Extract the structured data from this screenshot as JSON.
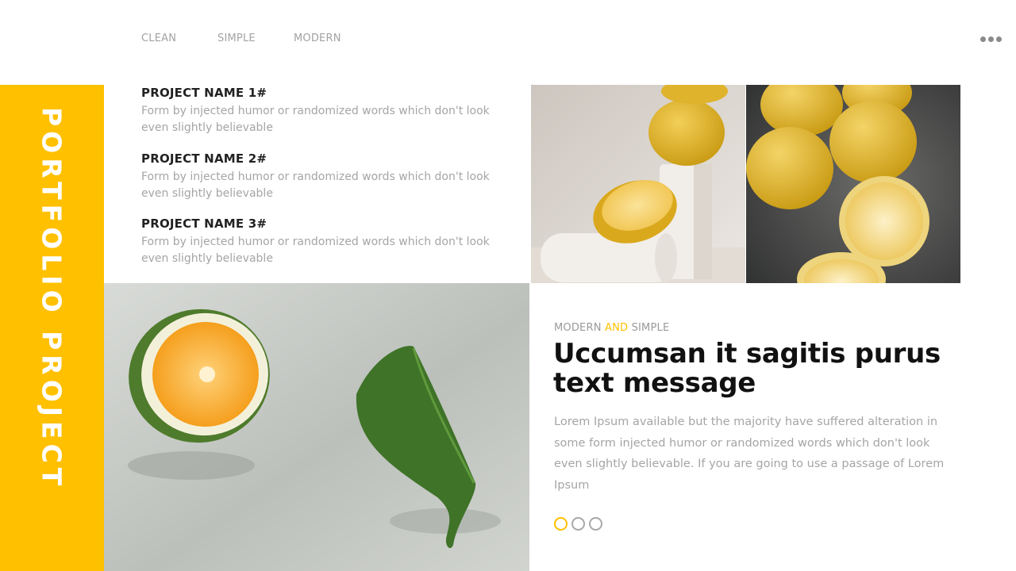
{
  "nav": {
    "items": [
      "CLEAN",
      "SIMPLE",
      "MODERN"
    ]
  },
  "side_title": "PORTFOLIO PROJECT",
  "projects": [
    {
      "name": "PROJECT NAME 1#",
      "desc": "Form by injected humor or randomized words which don't look even slightly believable"
    },
    {
      "name": "PROJECT NAME 2#",
      "desc": "Form by injected humor or randomized words which don't look even slightly believable"
    },
    {
      "name": "PROJECT NAME 3#",
      "desc": "Form by injected humor or randomized words which don't look even slightly believable"
    }
  ],
  "feature": {
    "tag_left": "MODERN",
    "tag_accent": "AND",
    "tag_right": "SIMPLE",
    "headline": "Uccumsan it sagitis purus text message",
    "body": "Lorem Ipsum available but the majority have suffered alteration in some form  injected humor or randomized words which don't look even slightly believable. If you are going to use a passage of Lorem Ipsum"
  },
  "pager": {
    "total": 3,
    "active": 1
  },
  "colors": {
    "accent": "#ffc000",
    "heading": "#111111",
    "muted": "#a5a5a5"
  },
  "icons": {
    "more": "more-dots-icon"
  }
}
